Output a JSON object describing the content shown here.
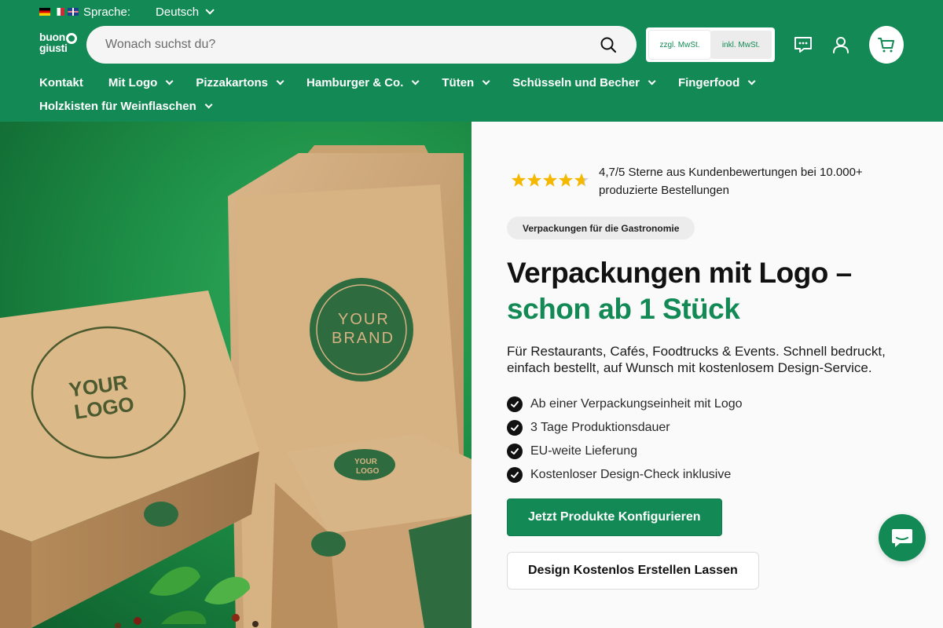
{
  "colors": {
    "brand": "#138a55",
    "brand_dark": "#0f7a4a",
    "star": "#f5b800"
  },
  "header": {
    "language_label": "Sprache:",
    "language_value": "Deutsch",
    "logo_line1": "buon",
    "logo_line2": "giusti",
    "search_placeholder": "Wonach suchst du?",
    "vat_excl": "zzgl. MwSt.",
    "vat_incl": "inkl. MwSt.",
    "icons": [
      "chat-icon",
      "account-icon",
      "cart-icon"
    ]
  },
  "nav": {
    "row1": [
      {
        "label": "Kontakt",
        "dropdown": false
      },
      {
        "label": "Mit Logo",
        "dropdown": true
      },
      {
        "label": "Pizzakartons",
        "dropdown": true
      },
      {
        "label": "Hamburger & Co.",
        "dropdown": true
      },
      {
        "label": "Tüten",
        "dropdown": true
      },
      {
        "label": "Schüsseln und Becher",
        "dropdown": true
      },
      {
        "label": "Fingerfood",
        "dropdown": true
      }
    ],
    "row2": [
      {
        "label": "Holzkisten für Weinflaschen",
        "dropdown": true
      }
    ]
  },
  "hero_image": {
    "pizza_box_text_1": "YOUR",
    "pizza_box_text_2": "LOGO",
    "bag_text_1": "YOUR",
    "bag_text_2": "BRAND",
    "burger_box_text_1": "YOUR",
    "burger_box_text_2": "LOGO"
  },
  "hero": {
    "rating_value": 4.7,
    "rating_text": "4,7/5 Sterne aus Kundenbewertungen bei 10.000+ produzierte Bestellungen",
    "pill": "Verpackungen für die Gastronomie",
    "title_line1": "Verpackungen mit Logo –",
    "title_line2": "schon ab 1 Stück",
    "subtitle": "Für Restaurants, Cafés, Foodtrucks & Events. Schnell bedruckt, einfach bestellt, auf Wunsch mit kostenlosem Design-Service.",
    "bullets": [
      "Ab einer Verpackungseinheit mit Logo",
      "3 Tage Produktionsdauer",
      "EU-weite Lieferung",
      "Kostenloser Design-Check inklusive"
    ],
    "cta_primary": "Jetzt Produkte Konfigurieren",
    "cta_secondary": "Design Kostenlos Erstellen Lassen"
  }
}
